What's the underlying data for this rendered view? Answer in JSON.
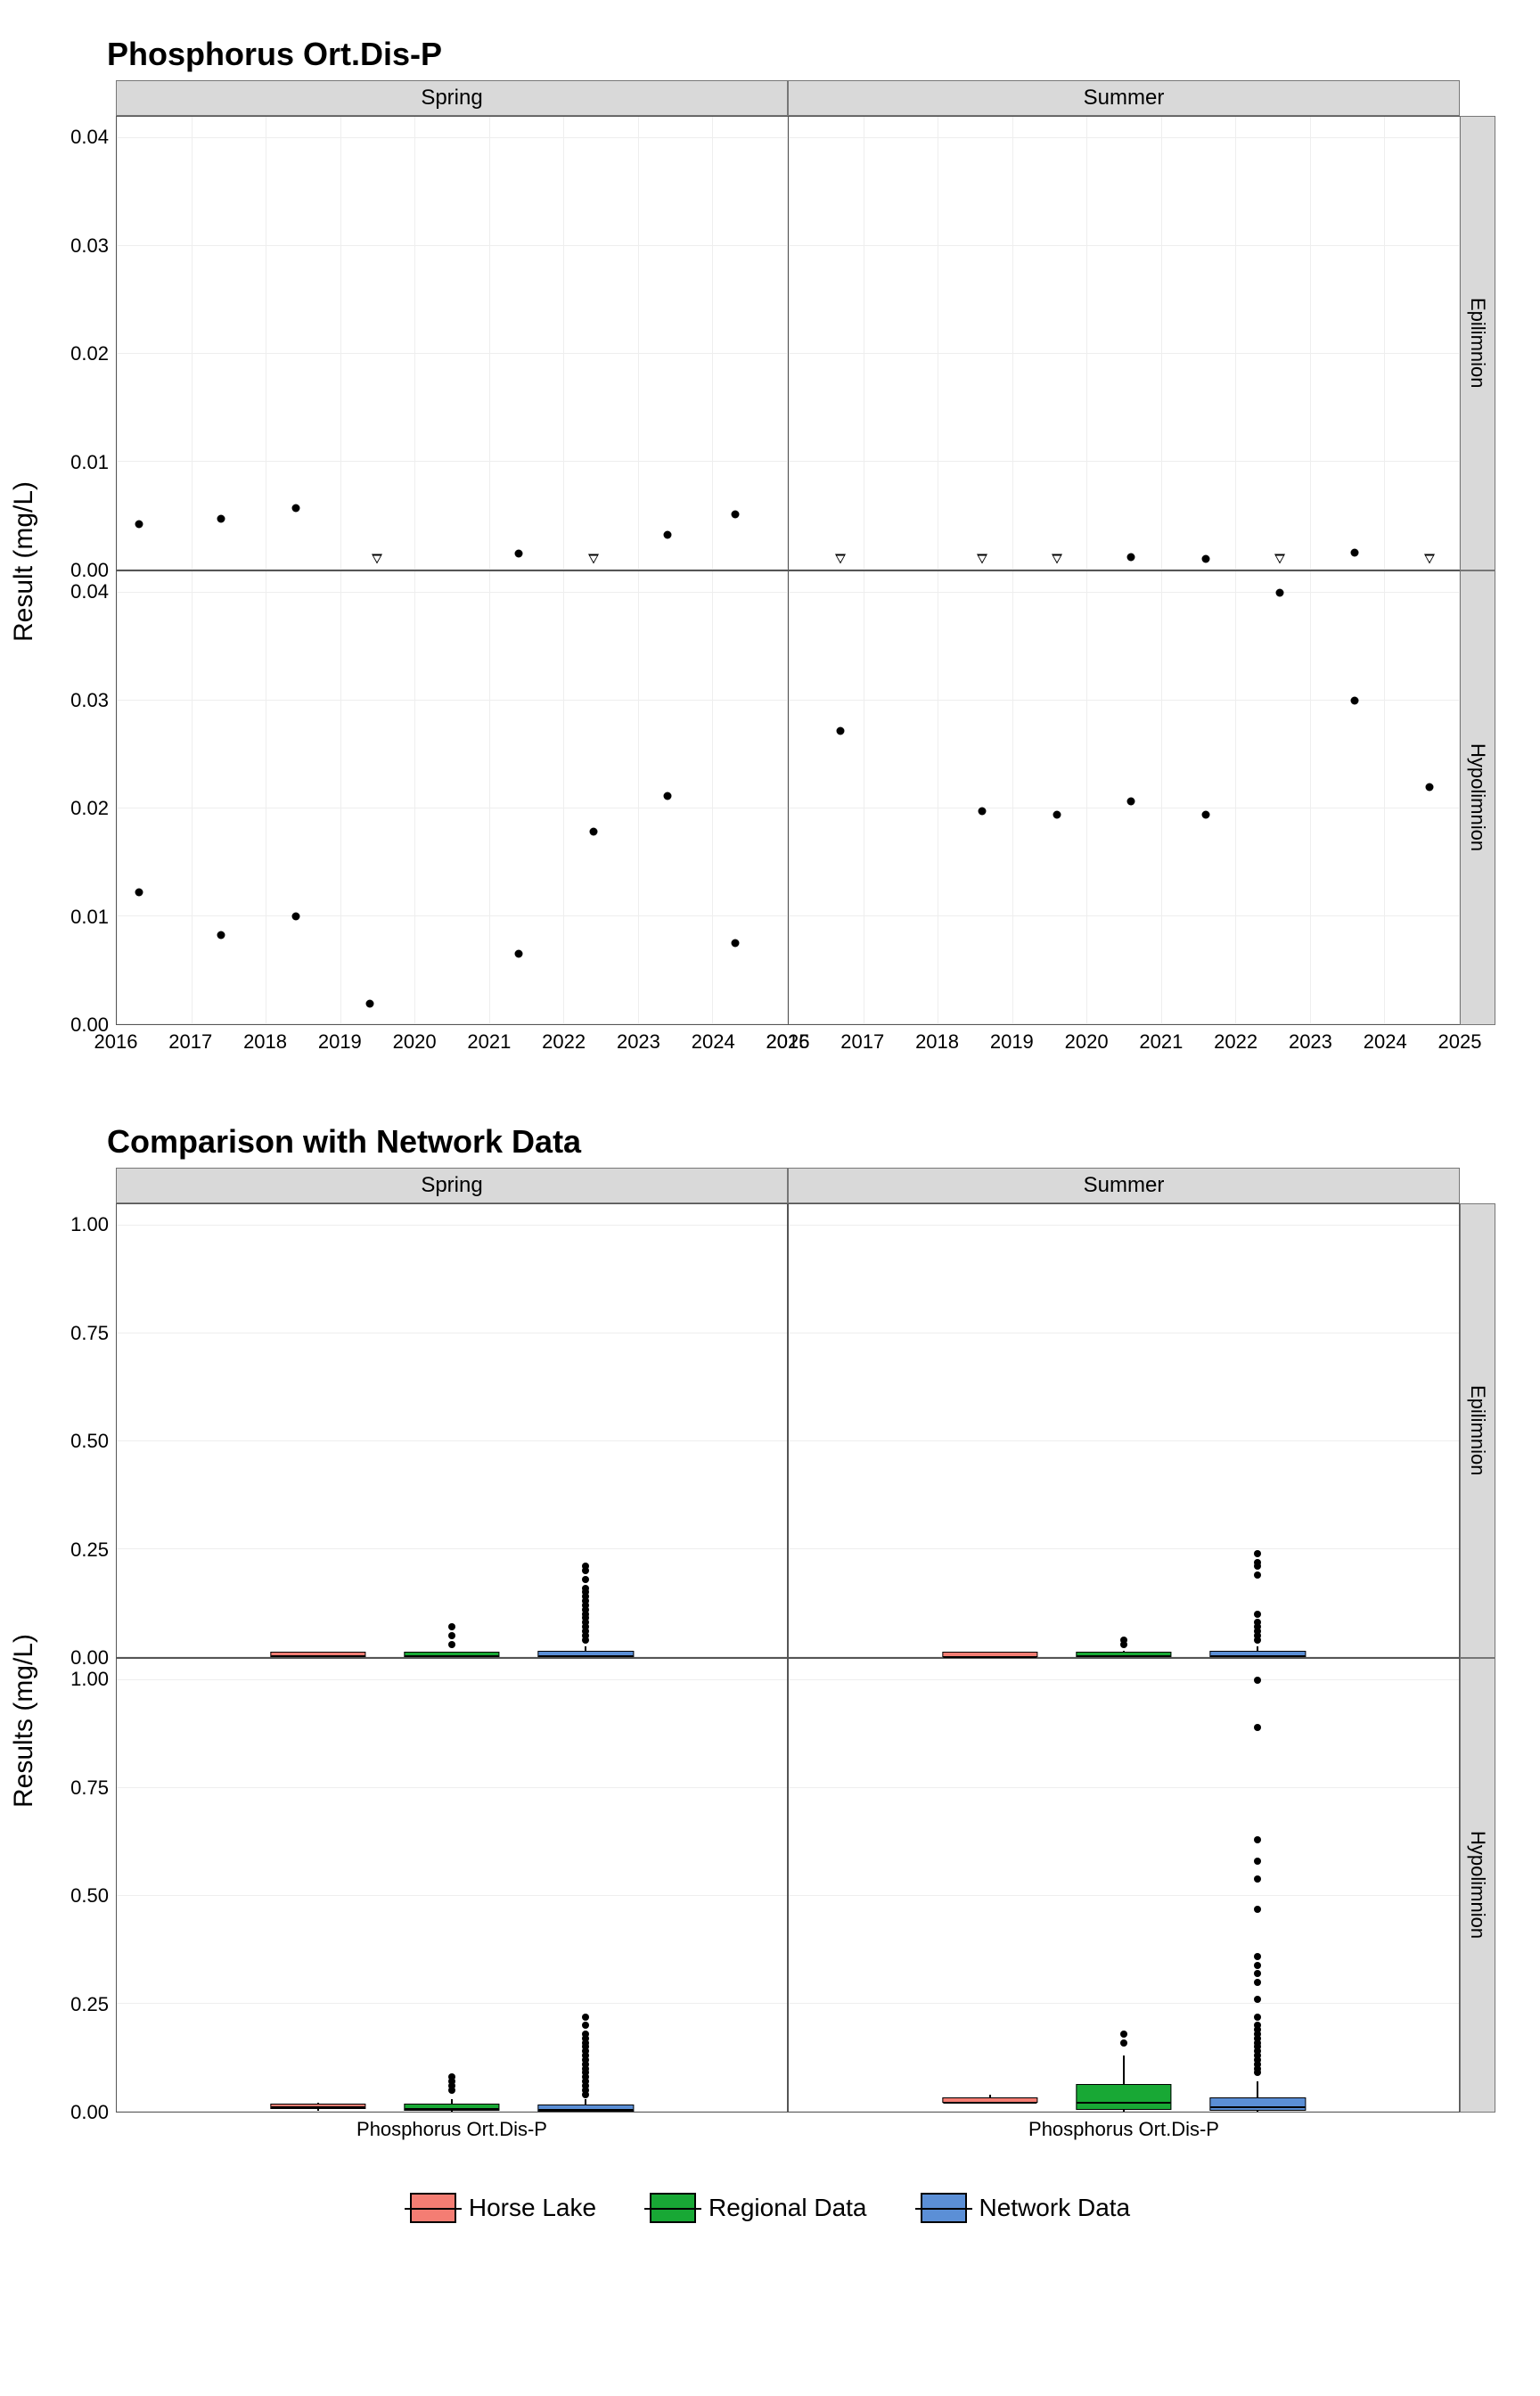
{
  "chart_data": [
    {
      "type": "scatter",
      "title": "Phosphorus Ort.Dis-P",
      "ylabel": "Result (mg/L)",
      "xlim": [
        2016,
        2025
      ],
      "ylim": [
        0,
        0.042
      ],
      "xticks": [
        2016,
        2017,
        2018,
        2019,
        2020,
        2021,
        2022,
        2023,
        2024,
        2025
      ],
      "yticks": [
        0.0,
        0.01,
        0.02,
        0.03,
        0.04
      ],
      "col_facets": [
        "Spring",
        "Summer"
      ],
      "row_facets": [
        "Epilimnion",
        "Hypolimnion"
      ],
      "series": [
        {
          "facet_col": "Spring",
          "facet_row": "Epilimnion",
          "shape": "point",
          "data": [
            {
              "x": 2016.3,
              "y": 0.0042
            },
            {
              "x": 2017.4,
              "y": 0.0047
            },
            {
              "x": 2018.4,
              "y": 0.0057
            },
            {
              "x": 2021.4,
              "y": 0.0015
            },
            {
              "x": 2023.4,
              "y": 0.0032
            },
            {
              "x": 2024.3,
              "y": 0.0051
            }
          ]
        },
        {
          "facet_col": "Spring",
          "facet_row": "Epilimnion",
          "shape": "open-triangle",
          "data": [
            {
              "x": 2019.5,
              "y": 0.001
            },
            {
              "x": 2022.4,
              "y": 0.001
            }
          ]
        },
        {
          "facet_col": "Summer",
          "facet_row": "Epilimnion",
          "shape": "point",
          "data": [
            {
              "x": 2020.6,
              "y": 0.0012
            },
            {
              "x": 2021.6,
              "y": 0.001
            },
            {
              "x": 2023.6,
              "y": 0.0016
            }
          ]
        },
        {
          "facet_col": "Summer",
          "facet_row": "Epilimnion",
          "shape": "open-triangle",
          "data": [
            {
              "x": 2016.7,
              "y": 0.001
            },
            {
              "x": 2018.6,
              "y": 0.001
            },
            {
              "x": 2019.6,
              "y": 0.001
            },
            {
              "x": 2022.6,
              "y": 0.001
            },
            {
              "x": 2024.6,
              "y": 0.001
            }
          ]
        },
        {
          "facet_col": "Spring",
          "facet_row": "Hypolimnion",
          "shape": "point",
          "data": [
            {
              "x": 2016.3,
              "y": 0.0122
            },
            {
              "x": 2017.4,
              "y": 0.0083
            },
            {
              "x": 2018.4,
              "y": 0.01
            },
            {
              "x": 2019.4,
              "y": 0.0019
            },
            {
              "x": 2021.4,
              "y": 0.0065
            },
            {
              "x": 2022.4,
              "y": 0.0179
            },
            {
              "x": 2023.4,
              "y": 0.0212
            },
            {
              "x": 2024.3,
              "y": 0.0075
            }
          ]
        },
        {
          "facet_col": "Summer",
          "facet_row": "Hypolimnion",
          "shape": "point",
          "data": [
            {
              "x": 2016.7,
              "y": 0.0272
            },
            {
              "x": 2018.6,
              "y": 0.0198
            },
            {
              "x": 2019.6,
              "y": 0.0194
            },
            {
              "x": 2020.6,
              "y": 0.0207
            },
            {
              "x": 2021.6,
              "y": 0.0194
            },
            {
              "x": 2022.6,
              "y": 0.04
            },
            {
              "x": 2023.6,
              "y": 0.03
            },
            {
              "x": 2024.6,
              "y": 0.022
            }
          ]
        }
      ]
    },
    {
      "type": "boxplot",
      "title": "Comparison with Network Data",
      "ylabel": "Results (mg/L)",
      "ylim": [
        0,
        1.05
      ],
      "yticks": [
        0.0,
        0.25,
        0.5,
        0.75,
        1.0
      ],
      "x_category": "Phosphorus Ort.Dis-P",
      "col_facets": [
        "Spring",
        "Summer"
      ],
      "row_facets": [
        "Epilimnion",
        "Hypolimnion"
      ],
      "groups": [
        "Horse Lake",
        "Regional Data",
        "Network Data"
      ],
      "colors": {
        "Horse Lake": "#f47d73",
        "Regional Data": "#18a835",
        "Network Data": "#5b8fd6"
      },
      "boxes": [
        {
          "col": "Spring",
          "row": "Epilimnion",
          "group": "Horse Lake",
          "q1": 0.001,
          "med": 0.002,
          "q3": 0.005,
          "lo": 0.001,
          "hi": 0.006,
          "outliers": []
        },
        {
          "col": "Spring",
          "row": "Epilimnion",
          "group": "Regional Data",
          "q1": 0.001,
          "med": 0.002,
          "q3": 0.006,
          "lo": 0.0,
          "hi": 0.012,
          "outliers": [
            0.03,
            0.05,
            0.07
          ]
        },
        {
          "col": "Spring",
          "row": "Epilimnion",
          "group": "Network Data",
          "q1": 0.001,
          "med": 0.003,
          "q3": 0.01,
          "lo": 0.0,
          "hi": 0.025,
          "outliers": [
            0.04,
            0.05,
            0.06,
            0.07,
            0.08,
            0.09,
            0.1,
            0.11,
            0.12,
            0.13,
            0.14,
            0.15,
            0.16,
            0.18,
            0.2,
            0.21
          ]
        },
        {
          "col": "Summer",
          "row": "Epilimnion",
          "group": "Horse Lake",
          "q1": 0.001,
          "med": 0.001,
          "q3": 0.002,
          "lo": 0.001,
          "hi": 0.002,
          "outliers": []
        },
        {
          "col": "Summer",
          "row": "Epilimnion",
          "group": "Regional Data",
          "q1": 0.001,
          "med": 0.002,
          "q3": 0.007,
          "lo": 0.0,
          "hi": 0.015,
          "outliers": [
            0.03,
            0.04
          ]
        },
        {
          "col": "Summer",
          "row": "Epilimnion",
          "group": "Network Data",
          "q1": 0.001,
          "med": 0.003,
          "q3": 0.01,
          "lo": 0.0,
          "hi": 0.025,
          "outliers": [
            0.04,
            0.05,
            0.06,
            0.07,
            0.08,
            0.1,
            0.19,
            0.21,
            0.22,
            0.24
          ]
        },
        {
          "col": "Spring",
          "row": "Hypolimnion",
          "group": "Horse Lake",
          "q1": 0.007,
          "med": 0.01,
          "q3": 0.015,
          "lo": 0.002,
          "hi": 0.021,
          "outliers": []
        },
        {
          "col": "Spring",
          "row": "Hypolimnion",
          "group": "Regional Data",
          "q1": 0.002,
          "med": 0.006,
          "q3": 0.015,
          "lo": 0.0,
          "hi": 0.03,
          "outliers": [
            0.05,
            0.06,
            0.07,
            0.08
          ]
        },
        {
          "col": "Spring",
          "row": "Hypolimnion",
          "group": "Network Data",
          "q1": 0.001,
          "med": 0.004,
          "q3": 0.012,
          "lo": 0.0,
          "hi": 0.03,
          "outliers": [
            0.04,
            0.05,
            0.06,
            0.07,
            0.08,
            0.09,
            0.1,
            0.11,
            0.12,
            0.13,
            0.14,
            0.15,
            0.16,
            0.17,
            0.18,
            0.2,
            0.22
          ]
        },
        {
          "col": "Summer",
          "row": "Hypolimnion",
          "group": "Horse Lake",
          "q1": 0.02,
          "med": 0.021,
          "q3": 0.028,
          "lo": 0.019,
          "hi": 0.04,
          "outliers": []
        },
        {
          "col": "Summer",
          "row": "Hypolimnion",
          "group": "Regional Data",
          "q1": 0.005,
          "med": 0.02,
          "q3": 0.06,
          "lo": 0.0,
          "hi": 0.13,
          "outliers": [
            0.16,
            0.18
          ]
        },
        {
          "col": "Summer",
          "row": "Hypolimnion",
          "group": "Network Data",
          "q1": 0.003,
          "med": 0.01,
          "q3": 0.03,
          "lo": 0.0,
          "hi": 0.07,
          "outliers": [
            0.09,
            0.1,
            0.11,
            0.12,
            0.13,
            0.14,
            0.15,
            0.16,
            0.17,
            0.18,
            0.19,
            0.2,
            0.22,
            0.26,
            0.3,
            0.32,
            0.34,
            0.36,
            0.47,
            0.54,
            0.58,
            0.63,
            0.89,
            1.0
          ]
        }
      ]
    }
  ],
  "t1": "Phosphorus Ort.Dis-P",
  "t2": "Comparison with Network Data",
  "yl1": "Result (mg/L)",
  "yl2": "Results (mg/L)",
  "c1": "Spring",
  "c2": "Summer",
  "r1": "Epilimnion",
  "r2": "Hypolimnion",
  "xcat": "Phosphorus Ort.Dis-P",
  "lg1": "Horse Lake",
  "lg2": "Regional Data",
  "lg3": "Network Data"
}
